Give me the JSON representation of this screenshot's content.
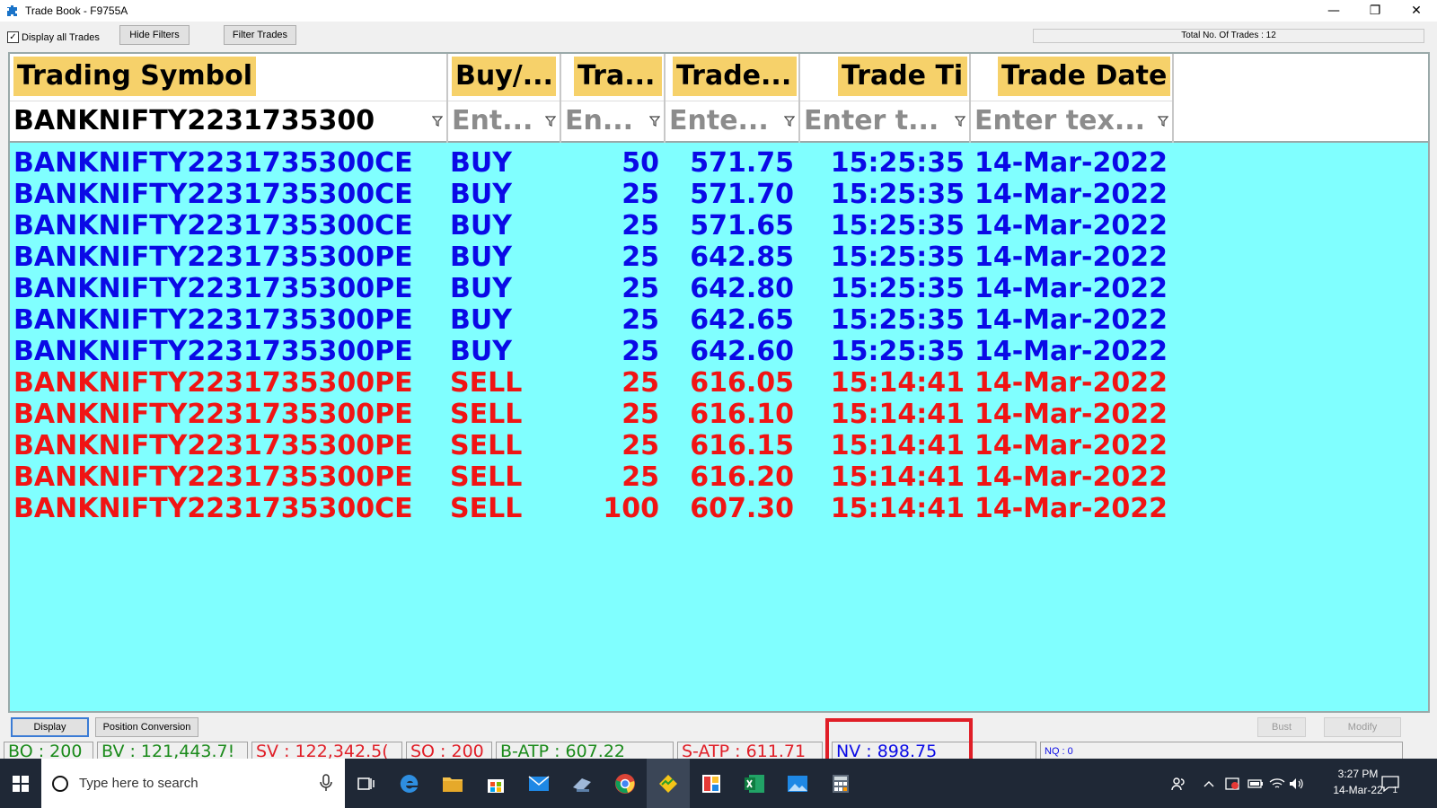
{
  "window": {
    "title": "Trade Book - F9755A",
    "minimize": "—",
    "restore": "❐",
    "close": "✕"
  },
  "toolbar": {
    "display_all_label": "Display all Trades",
    "display_all_checked": "✓",
    "hide_filters": "Hide Filters",
    "filter_trades": "Filter Trades",
    "total_trades": "Total No. Of Trades : 12"
  },
  "grid": {
    "columns": [
      {
        "header": "Trading Symbol",
        "filter": "BANKNIFTY2231735300",
        "filled": true
      },
      {
        "header": "Buy/...",
        "filter": "Ent...",
        "filled": false
      },
      {
        "header": "Tra...",
        "filter": "En...",
        "filled": false
      },
      {
        "header": "Trade...",
        "filter": "Ente...",
        "filled": false
      },
      {
        "header": "Trade Ti",
        "filter": "Enter t...",
        "filled": false
      },
      {
        "header": "Trade Date",
        "filter": "Enter tex...",
        "filled": false
      }
    ],
    "rows": [
      {
        "side": "buy",
        "symbol": "BANKNIFTY2231735300CE",
        "type": "BUY",
        "qty": "50",
        "price": "571.75",
        "time": "15:25:35",
        "date": "14-Mar-2022"
      },
      {
        "side": "buy",
        "symbol": "BANKNIFTY2231735300CE",
        "type": "BUY",
        "qty": "25",
        "price": "571.70",
        "time": "15:25:35",
        "date": "14-Mar-2022"
      },
      {
        "side": "buy",
        "symbol": "BANKNIFTY2231735300CE",
        "type": "BUY",
        "qty": "25",
        "price": "571.65",
        "time": "15:25:35",
        "date": "14-Mar-2022"
      },
      {
        "side": "buy",
        "symbol": "BANKNIFTY2231735300PE",
        "type": "BUY",
        "qty": "25",
        "price": "642.85",
        "time": "15:25:35",
        "date": "14-Mar-2022"
      },
      {
        "side": "buy",
        "symbol": "BANKNIFTY2231735300PE",
        "type": "BUY",
        "qty": "25",
        "price": "642.80",
        "time": "15:25:35",
        "date": "14-Mar-2022"
      },
      {
        "side": "buy",
        "symbol": "BANKNIFTY2231735300PE",
        "type": "BUY",
        "qty": "25",
        "price": "642.65",
        "time": "15:25:35",
        "date": "14-Mar-2022"
      },
      {
        "side": "buy",
        "symbol": "BANKNIFTY2231735300PE",
        "type": "BUY",
        "qty": "25",
        "price": "642.60",
        "time": "15:25:35",
        "date": "14-Mar-2022"
      },
      {
        "side": "sell",
        "symbol": "BANKNIFTY2231735300PE",
        "type": "SELL",
        "qty": "25",
        "price": "616.05",
        "time": "15:14:41",
        "date": "14-Mar-2022"
      },
      {
        "side": "sell",
        "symbol": "BANKNIFTY2231735300PE",
        "type": "SELL",
        "qty": "25",
        "price": "616.10",
        "time": "15:14:41",
        "date": "14-Mar-2022"
      },
      {
        "side": "sell",
        "symbol": "BANKNIFTY2231735300PE",
        "type": "SELL",
        "qty": "25",
        "price": "616.15",
        "time": "15:14:41",
        "date": "14-Mar-2022"
      },
      {
        "side": "sell",
        "symbol": "BANKNIFTY2231735300PE",
        "type": "SELL",
        "qty": "25",
        "price": "616.20",
        "time": "15:14:41",
        "date": "14-Mar-2022"
      },
      {
        "side": "sell",
        "symbol": "BANKNIFTY2231735300CE",
        "type": "SELL",
        "qty": "100",
        "price": "607.30",
        "time": "15:14:41",
        "date": "14-Mar-2022"
      }
    ]
  },
  "buttons": {
    "display": "Display",
    "position_conversion": "Position Conversion",
    "bust": "Bust",
    "modify": "Modify"
  },
  "status": {
    "bo": "BO : 200",
    "bv": "BV : 121,443.7!",
    "sv": "SV : 122,342.5(",
    "so": "SO : 200",
    "batp": "B-ATP : 607.22",
    "satp": "S-ATP : 611.71",
    "nv": "NV : 898.75",
    "nq": "NQ : 0"
  },
  "taskbar": {
    "search_placeholder": "Type here to search",
    "time": "3:27 PM",
    "date": "14-Mar-22",
    "notifications": "1"
  },
  "colors": {
    "grid_bg": "#80ffff",
    "header_bg": "#f6d16a",
    "buy_text": "#0a0ae6",
    "sell_text": "#f01414",
    "highlight_frame": "#e01e27"
  }
}
